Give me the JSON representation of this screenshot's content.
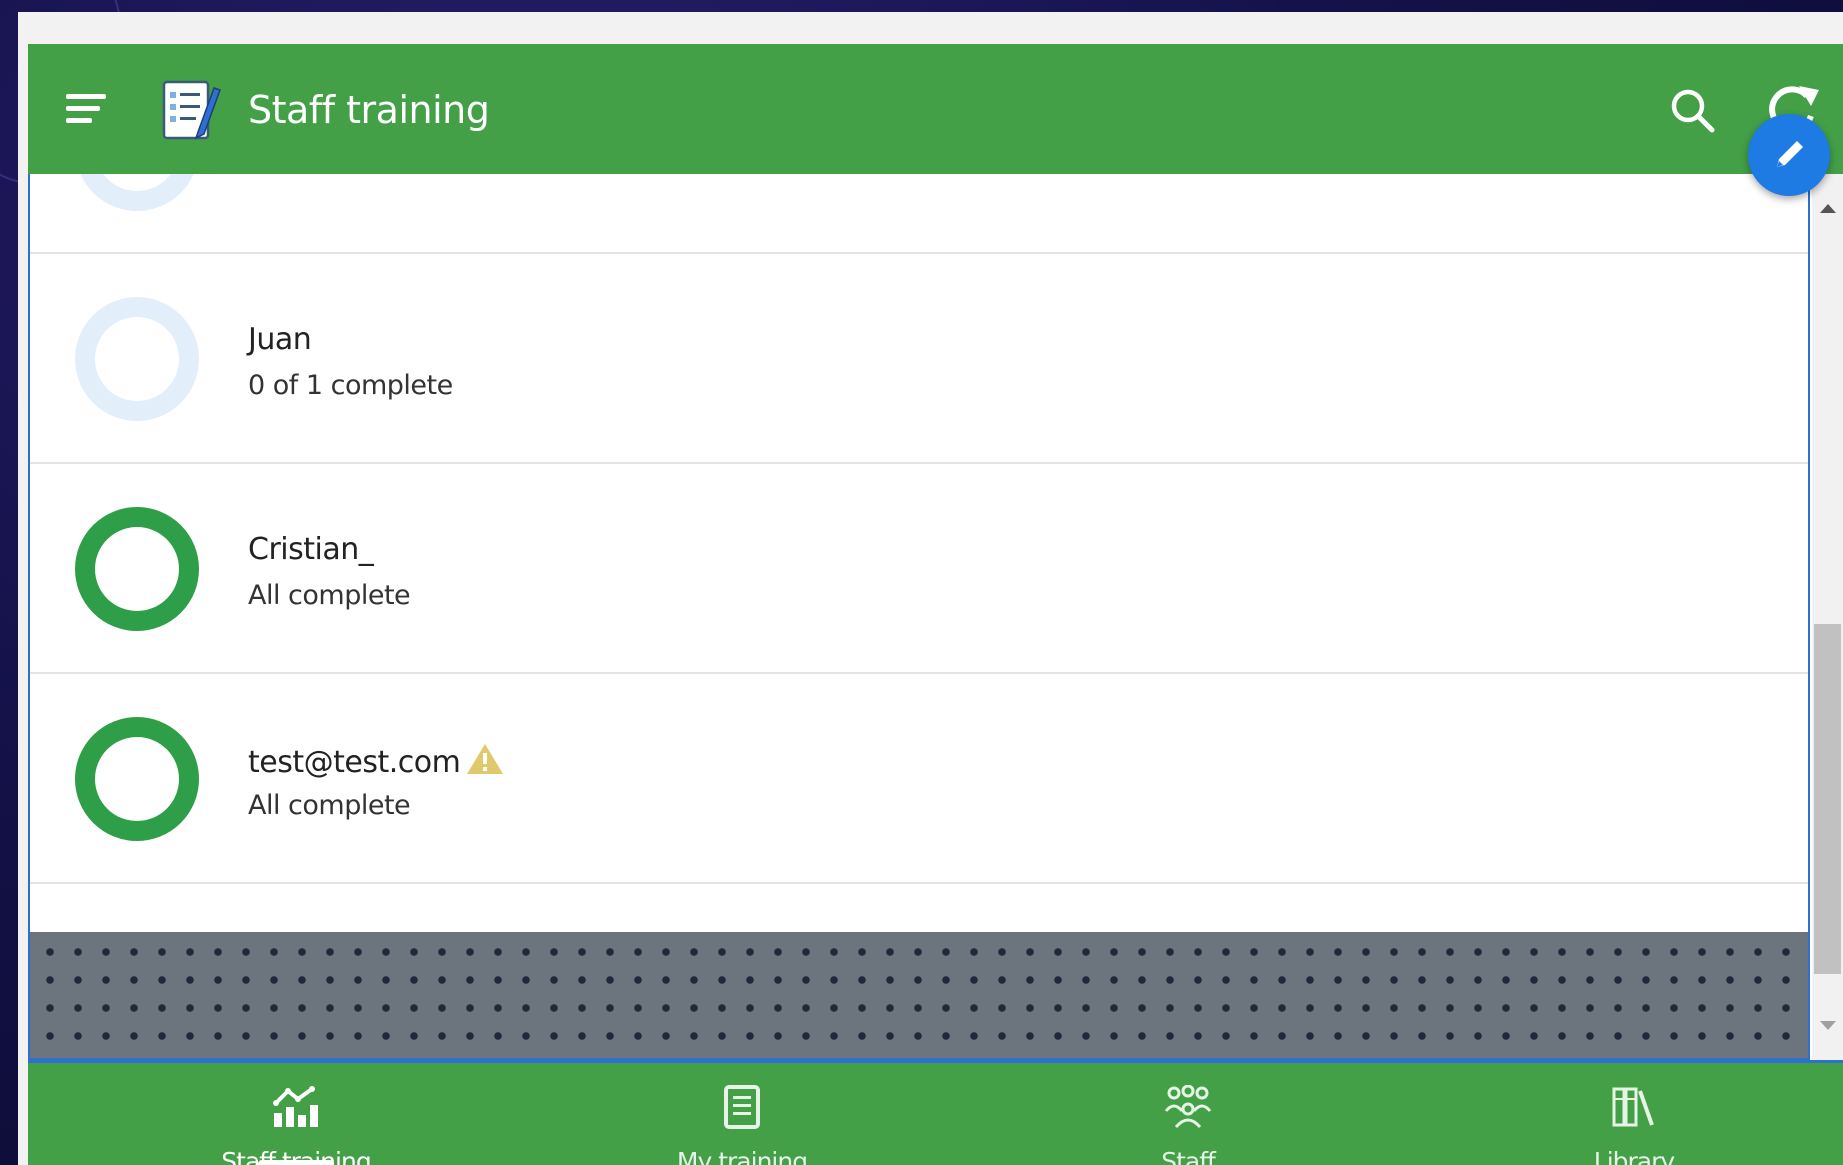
{
  "header": {
    "title": "Staff training"
  },
  "rows": [
    {
      "name": "Juan",
      "status": "0 of 1 complete",
      "ring": "not-started",
      "warning": false
    },
    {
      "name": "Cristian_",
      "status": "All complete",
      "ring": "complete",
      "warning": false
    },
    {
      "name": "test@test.com",
      "status": "All complete",
      "ring": "complete",
      "warning": true
    }
  ],
  "bottom_nav": [
    {
      "label": "Staff training",
      "icon": "chart-icon",
      "active": true
    },
    {
      "label": "My training",
      "icon": "book-icon",
      "active": false
    },
    {
      "label": "Staff",
      "icon": "people-icon",
      "active": false
    },
    {
      "label": "Library",
      "icon": "library-icon",
      "active": false
    }
  ],
  "colors": {
    "primary": "#43a047",
    "complete": "#2e9e48",
    "not_started": "#e3eefb",
    "fab": "#1e7be3",
    "warning": "#e0c96a"
  }
}
